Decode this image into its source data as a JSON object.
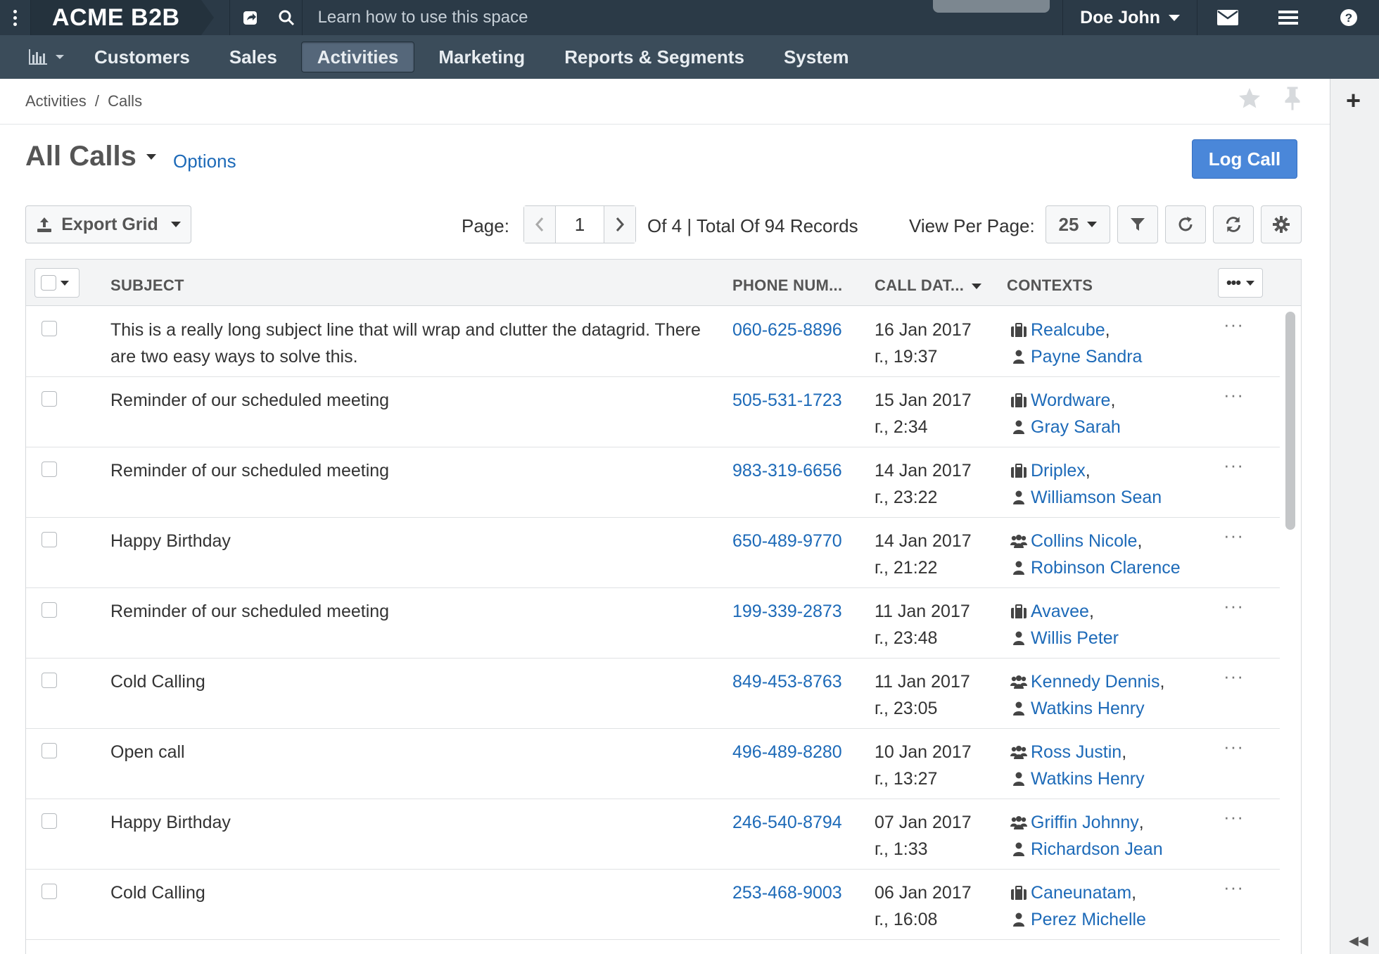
{
  "topbar": {
    "brand": "ACME B2B",
    "learn_text": "Learn how to use this space",
    "user_name": "Doe John"
  },
  "menu": {
    "items": [
      {
        "label": "Customers",
        "active": false
      },
      {
        "label": "Sales",
        "active": false
      },
      {
        "label": "Activities",
        "active": true
      },
      {
        "label": "Marketing",
        "active": false
      },
      {
        "label": "Reports & Segments",
        "active": false
      },
      {
        "label": "System",
        "active": false
      }
    ]
  },
  "breadcrumb": {
    "parent": "Activities",
    "separator": "/",
    "current": "Calls"
  },
  "page": {
    "title": "All Calls",
    "options_label": "Options",
    "log_call_label": "Log Call"
  },
  "toolbar": {
    "export_label": "Export Grid",
    "page_label": "Page:",
    "page_number": "1",
    "of_records": "Of 4 | Total Of 94 Records",
    "view_per_page_label": "View Per Page:",
    "per_page": "25"
  },
  "grid": {
    "columns": {
      "subject": "SUBJECT",
      "phone": "PHONE NUM...",
      "call_date": "CALL DAT...",
      "contexts": "CONTEXTS"
    },
    "rows": [
      {
        "subject": "This is a really long subject line that will wrap and clutter the datagrid. There are two easy ways to solve this.",
        "phone": "060-625-8896",
        "date_line1": "16 Jan 2017",
        "date_line2": "г., 19:37",
        "ctx1": "Realcube",
        "ctx1_icon": "briefcase-icon",
        "ctx2": "Payne Sandra"
      },
      {
        "subject": "Reminder of our scheduled meeting",
        "phone": "505-531-1723",
        "date_line1": "15 Jan 2017",
        "date_line2": "г., 2:34",
        "ctx1": "Wordware",
        "ctx1_icon": "briefcase-icon",
        "ctx2": "Gray Sarah"
      },
      {
        "subject": "Reminder of our scheduled meeting",
        "phone": "983-319-6656",
        "date_line1": "14 Jan 2017",
        "date_line2": "г., 23:22",
        "ctx1": "Driplex",
        "ctx1_icon": "briefcase-icon",
        "ctx2": "Williamson Sean"
      },
      {
        "subject": "Happy Birthday",
        "phone": "650-489-9770",
        "date_line1": "14 Jan 2017",
        "date_line2": "г., 21:22",
        "ctx1": "Collins Nicole",
        "ctx1_icon": "users-icon",
        "ctx2": "Robinson Clarence"
      },
      {
        "subject": "Reminder of our scheduled meeting",
        "phone": "199-339-2873",
        "date_line1": "11 Jan 2017",
        "date_line2": "г., 23:48",
        "ctx1": "Avavee",
        "ctx1_icon": "briefcase-icon",
        "ctx2": "Willis Peter"
      },
      {
        "subject": "Cold Calling",
        "phone": "849-453-8763",
        "date_line1": "11 Jan 2017",
        "date_line2": "г., 23:05",
        "ctx1": "Kennedy Dennis",
        "ctx1_icon": "users-icon",
        "ctx2": "Watkins Henry"
      },
      {
        "subject": "Open call",
        "phone": "496-489-8280",
        "date_line1": "10 Jan 2017",
        "date_line2": "г., 13:27",
        "ctx1": "Ross Justin",
        "ctx1_icon": "users-icon",
        "ctx2": "Watkins Henry"
      },
      {
        "subject": "Happy Birthday",
        "phone": "246-540-8794",
        "date_line1": "07 Jan 2017",
        "date_line2": "г., 1:33",
        "ctx1": "Griffin Johnny",
        "ctx1_icon": "users-icon",
        "ctx2": "Richardson Jean"
      },
      {
        "subject": "Cold Calling",
        "phone": "253-468-9003",
        "date_line1": "06 Jan 2017",
        "date_line2": "г., 16:08",
        "ctx1": "Caneunatam",
        "ctx1_icon": "briefcase-icon",
        "ctx2": "Perez Michelle"
      }
    ],
    "row_actions_label": "···"
  },
  "colors": {
    "topbar": "#2b3a47",
    "menubar": "#3b4c5a",
    "link": "#1d6ab8",
    "primary_button": "#4a87d9"
  }
}
